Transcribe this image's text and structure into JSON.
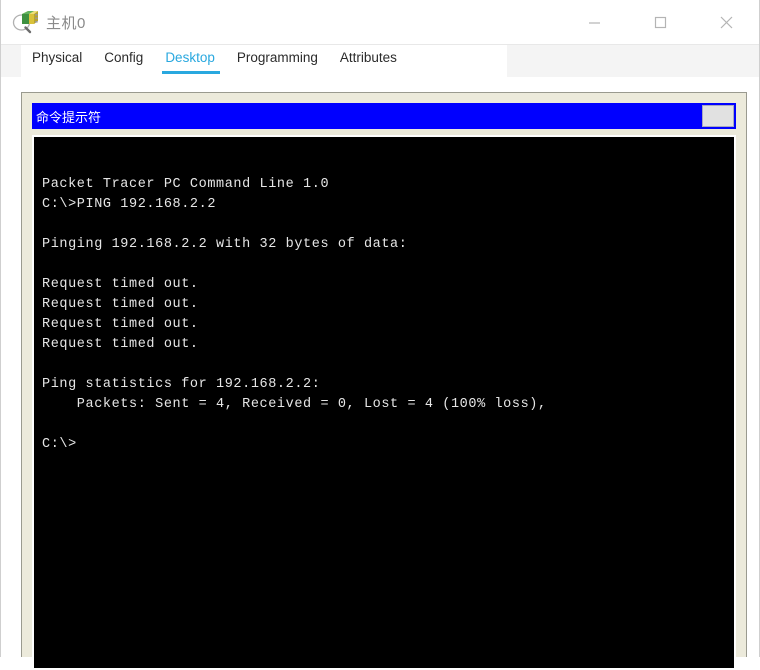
{
  "window": {
    "title": "主机0",
    "icon": "packet-tracer-device-icon",
    "controls": {
      "minimize": "—",
      "maximize": "▢",
      "close": "✕"
    }
  },
  "tabs": [
    {
      "label": "Physical",
      "active": false
    },
    {
      "label": "Config",
      "active": false
    },
    {
      "label": "Desktop",
      "active": true
    },
    {
      "label": "Programming",
      "active": false
    },
    {
      "label": "Attributes",
      "active": false
    }
  ],
  "command_prompt": {
    "title": "命令提示符",
    "restore_button_label": "",
    "terminal_lines": [
      "",
      "Packet Tracer PC Command Line 1.0",
      "C:\\>PING 192.168.2.2",
      "",
      "Pinging 192.168.2.2 with 32 bytes of data:",
      "",
      "Request timed out.",
      "Request timed out.",
      "Request timed out.",
      "Request timed out.",
      "",
      "Ping statistics for 192.168.2.2:",
      "    Packets: Sent = 4, Received = 0, Lost = 4 (100% loss),",
      "",
      "C:\\>"
    ]
  },
  "colors": {
    "accent_tab": "#29a8df",
    "cmd_titlebar": "#0000ff",
    "panel_background": "#eceadb",
    "terminal_background": "#000000",
    "terminal_text": "#e6e6e6"
  }
}
